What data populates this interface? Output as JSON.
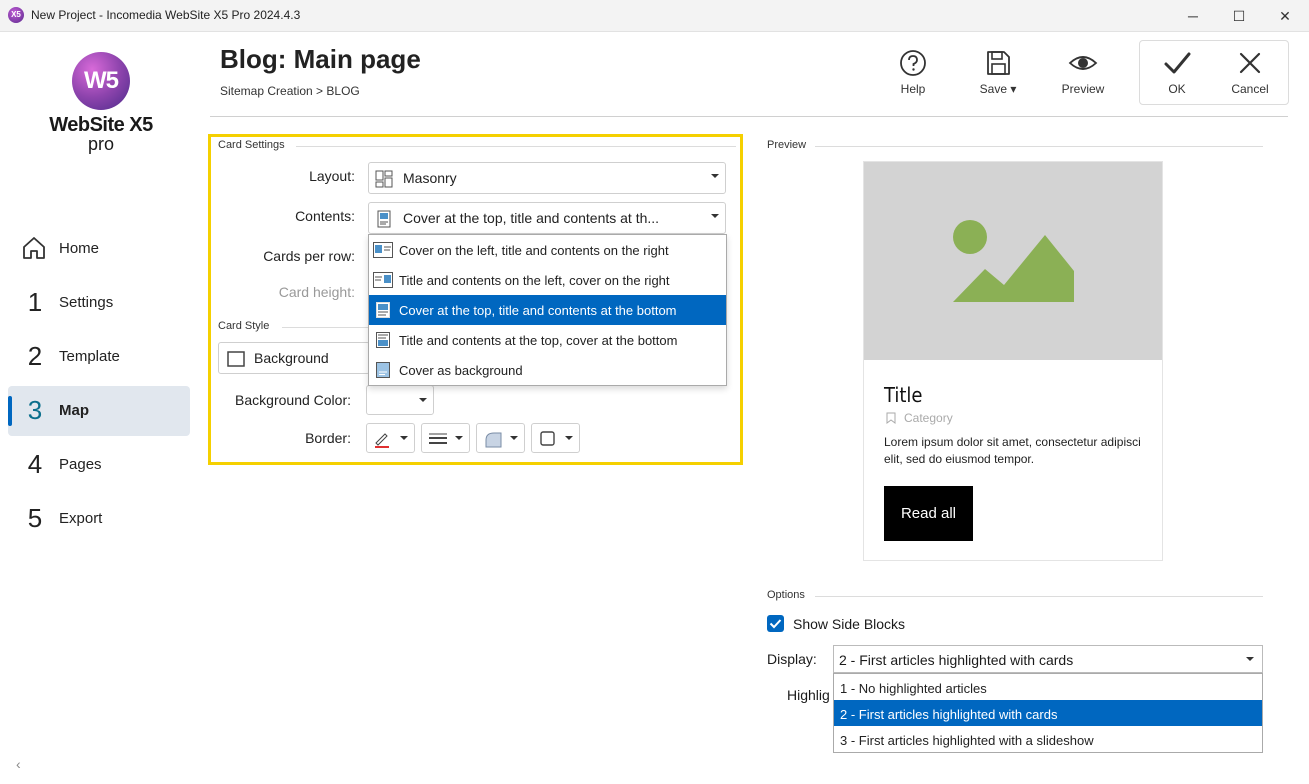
{
  "window": {
    "title": "New Project - Incomedia WebSite X5 Pro 2024.4.3",
    "app_icon_text": "X5",
    "controls": [
      "─",
      "☐",
      "✕"
    ]
  },
  "logo": {
    "mark": "W5",
    "name": "WebSite X5",
    "edition": "pro"
  },
  "sidebar": {
    "items": [
      {
        "num": "",
        "label": "Home"
      },
      {
        "num": "1",
        "label": "Settings"
      },
      {
        "num": "2",
        "label": "Template"
      },
      {
        "num": "3",
        "label": "Map",
        "active": true
      },
      {
        "num": "4",
        "label": "Pages"
      },
      {
        "num": "5",
        "label": "Export"
      }
    ],
    "collapse_glyph": "‹"
  },
  "header": {
    "title": "Blog: Main page",
    "breadcrumb": "Sitemap Creation > BLOG",
    "toolbar": {
      "help": "Help",
      "save": "Save",
      "preview": "Preview",
      "ok": "OK",
      "cancel": "Cancel"
    }
  },
  "card_settings": {
    "group_label": "Card Settings",
    "layout_label": "Layout:",
    "layout_value": "Masonry",
    "contents_label": "Contents:",
    "contents_value": "Cover at the top, title and contents at th...",
    "cards_per_row_label": "Cards per row:",
    "card_height_label": "Card height:",
    "contents_options": [
      "Cover on the left, title and contents on the right",
      "Title and contents on the left, cover on the right",
      "Cover at the top, title and contents at the bottom",
      "Title and contents at the top, cover at the bottom",
      "Cover as background"
    ],
    "selected_index": 2
  },
  "card_style": {
    "group_label": "Card Style",
    "background_value": "Background",
    "bg_color_label": "Background Color:",
    "border_label": "Border:"
  },
  "preview": {
    "group_label": "Preview",
    "card_title": "Title",
    "category": "Category",
    "text": "Lorem ipsum dolor sit amet, consectetur adipisci elit, sed do eiusmod tempor.",
    "button": "Read all",
    "image_bg": "#d3d3d3",
    "image_fg": "#8bb055"
  },
  "options": {
    "group_label": "Options",
    "show_side_blocks": "Show Side Blocks",
    "show_side_blocks_checked": true,
    "display_label": "Display:",
    "display_value": "2 - First articles highlighted with cards",
    "highlight_label_partial": "Highlig",
    "display_options": [
      "1 - No highlighted articles",
      "2 - First articles highlighted with cards",
      "3 - First articles highlighted with a slideshow"
    ],
    "display_selected_index": 1
  },
  "colors": {
    "accent": "#0067c0",
    "highlight_border": "#f5d000",
    "nav_active_bg": "#e1e7ee"
  }
}
